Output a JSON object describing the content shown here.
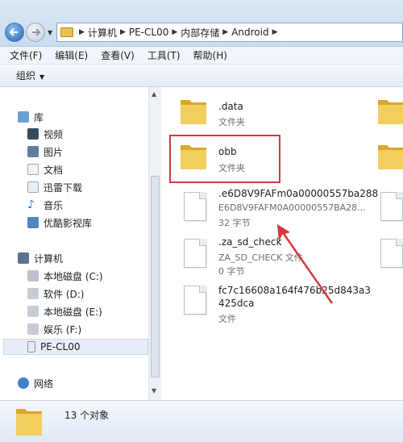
{
  "breadcrumb": [
    "计算机",
    "PE-CL00",
    "内部存储",
    "Android"
  ],
  "menu": [
    "文件(F)",
    "编辑(E)",
    "查看(V)",
    "工具(T)",
    "帮助(H)"
  ],
  "toolbar": {
    "organize": "组织"
  },
  "sidebar": {
    "libraries": "库",
    "library_items": [
      "视频",
      "图片",
      "文档",
      "迅雷下载",
      "音乐",
      "优酷影视库"
    ],
    "computer": "计算机",
    "drives": [
      "本地磁盘 (C:)",
      "软件 (D:)",
      "本地磁盘 (E:)",
      "娱乐 (F:)",
      "PE-CL00"
    ],
    "network": "网络"
  },
  "files": [
    {
      "name": ".data",
      "type": "文件夹",
      "icon": "folder-icon"
    },
    {
      "name": "obb",
      "type": "文件夹",
      "icon": "folder-icon",
      "highlighted": true
    },
    {
      "name": ".e6D8V9FAFm0a00000557ba288",
      "type": "E6D8V9FAFM0A00000557BA28...",
      "size": "32 字节",
      "icon": "file-icon"
    },
    {
      "name": ".za_sd_check",
      "type": "ZA_SD_CHECK 文件",
      "size": "0 字节",
      "icon": "file-icon"
    },
    {
      "name": "fc7c16608a164f476b25d843a3425dca",
      "type": "文件",
      "icon": "file-icon"
    }
  ],
  "status": {
    "count": "13 个对象"
  },
  "colors": {
    "highlight": "#d8383d",
    "folder": "#e9c24d",
    "accent": "#1f5fae"
  }
}
